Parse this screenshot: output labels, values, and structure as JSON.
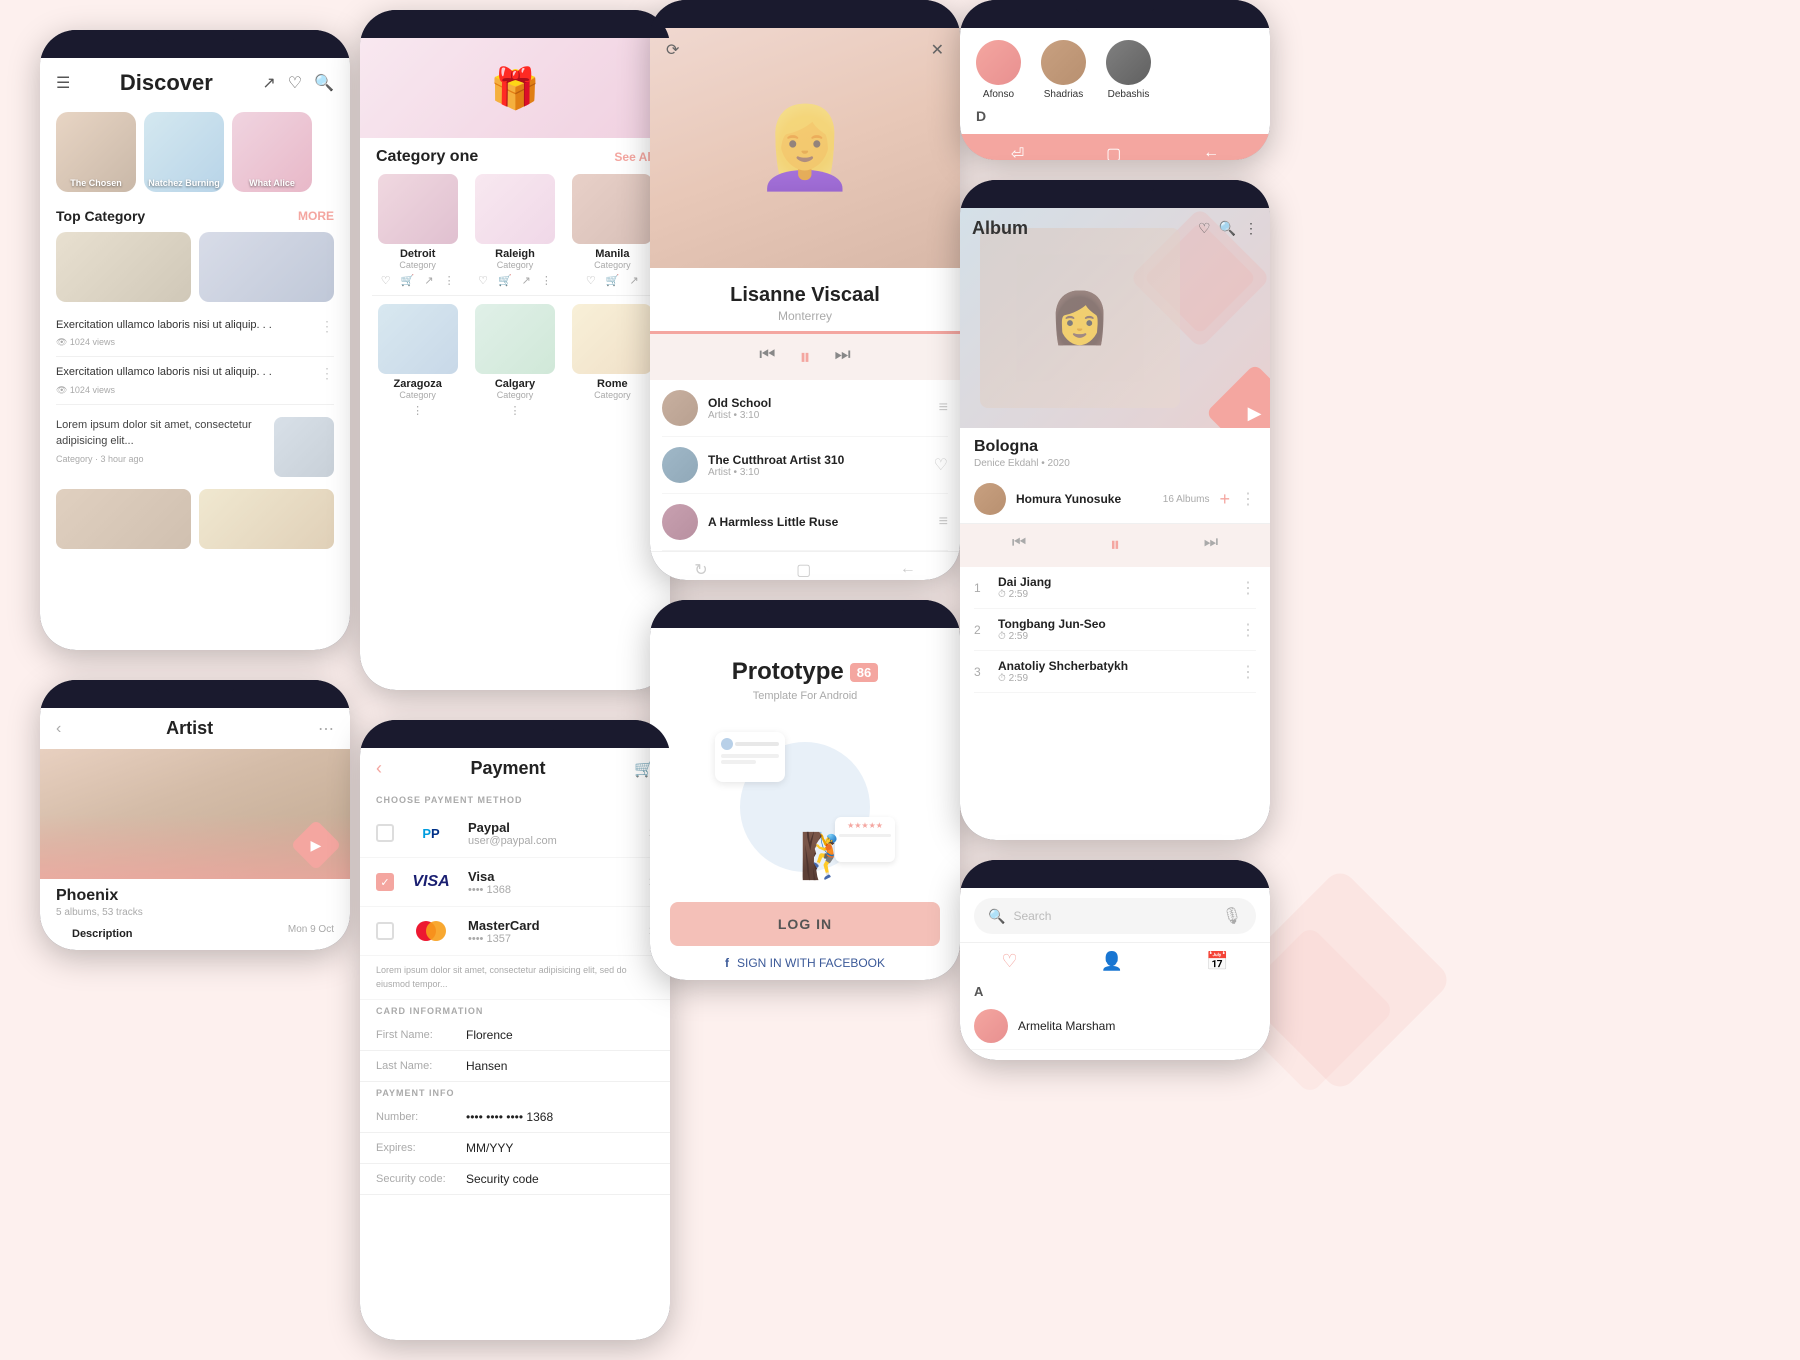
{
  "phones": {
    "discover": {
      "title": "Discover",
      "carousel": [
        {
          "label": "The Chosen",
          "bg": "ci-bg1"
        },
        {
          "label": "Natchez Burning",
          "bg": "ci-bg2"
        },
        {
          "label": "What Alice",
          "bg": "ci-bg3"
        }
      ],
      "topCategory": "Top Category",
      "more": "MORE",
      "listItems": [
        {
          "text": "Exercitation ullamco laboris nisi ut aliquip...",
          "views": "1024 views"
        },
        {
          "text": "Exercitation ullamco laboris nisi ut aliquip...",
          "views": "1024 views"
        }
      ],
      "article": "Lorem ipsum dolor sit amet, consectetur adipisicing elit...",
      "articleMeta": "Category · 3 hour ago"
    },
    "artist": {
      "title": "Artist",
      "name": "Phoenix",
      "sub": "5 albums, 53 tracks",
      "desc": "Description",
      "date": "Mon 9 Oct"
    },
    "category": {
      "sectionTitle": "Category one",
      "seeAll": "See All",
      "items": [
        {
          "name": "Detroit",
          "sub": "Category"
        },
        {
          "name": "Raleigh",
          "sub": "Category"
        },
        {
          "name": "Manila",
          "sub": "Category"
        },
        {
          "name": "Zaragoza",
          "sub": "Category"
        },
        {
          "name": "Calgary",
          "sub": "Category"
        },
        {
          "name": "Rome",
          "sub": "Category"
        }
      ]
    },
    "payment": {
      "title": "Payment",
      "chooseMethod": "CHOOSE PAYMENT METHOD",
      "methods": [
        {
          "name": "Paypal",
          "sub": "user@paypal.com",
          "logo": "PayPal",
          "checked": false
        },
        {
          "name": "Visa",
          "sub": "•••• 1368",
          "logo": "VISA",
          "checked": true
        },
        {
          "name": "MasterCard",
          "sub": "•••• 1357",
          "logo": "MC",
          "checked": false
        }
      ],
      "loremText": "Lorem ipsum dolor sit amet, consectetur adipisicing elit, sed do eiusmod tempor...",
      "cardInfo": "CARD INFORMATION",
      "fields": [
        {
          "label": "First Name:",
          "value": "Florence"
        },
        {
          "label": "Last Name:",
          "value": "Hansen"
        }
      ],
      "paymentInfo": "PAYMENT INFO",
      "payFields": [
        {
          "label": "Number:",
          "value": "•••• •••• •••• 1368"
        },
        {
          "label": "Expires:",
          "value": "MM/YYY"
        },
        {
          "label": "Security code:",
          "value": "Security code"
        }
      ]
    },
    "musicPlayer": {
      "artistName": "Lisanne Viscaal",
      "city": "Monterrey",
      "tracks": [
        {
          "name": "Old School",
          "sub": "Artist • 3:10"
        },
        {
          "name": "The Cutthroat Artist 310",
          "sub": "Artist • 3:10"
        },
        {
          "name": "A Harmless Little Ruse",
          "sub": ""
        }
      ]
    },
    "prototype": {
      "name": "Prototype",
      "badge": "86",
      "sub": "Template For Android",
      "loginBtn": "LOG IN",
      "facebookText": "SIGN IN WITH FACEBOOK"
    },
    "contacts": {
      "contacts": [
        {
          "name": "Afonso"
        },
        {
          "name": "Shadrias"
        },
        {
          "name": "Debashis"
        }
      ],
      "letter": "D"
    },
    "album": {
      "title": "Album",
      "albumName": "Bologna",
      "albumSub": "Denice Ekdahl • 2020",
      "artistName": "Homura Yunosuke",
      "artistCount": "16 Albums",
      "tracks": [
        {
          "num": "1",
          "name": "Dai Jiang",
          "time": "2:59"
        },
        {
          "num": "2",
          "name": "Tongbang Jun-Seo",
          "time": "2:59"
        },
        {
          "num": "3",
          "name": "Anatoliy Shcherbatykh",
          "time": "2:59"
        }
      ]
    },
    "search": {
      "placeholder": "Search",
      "contactLetter": "A",
      "contactName": "Armelita Marsham"
    }
  }
}
